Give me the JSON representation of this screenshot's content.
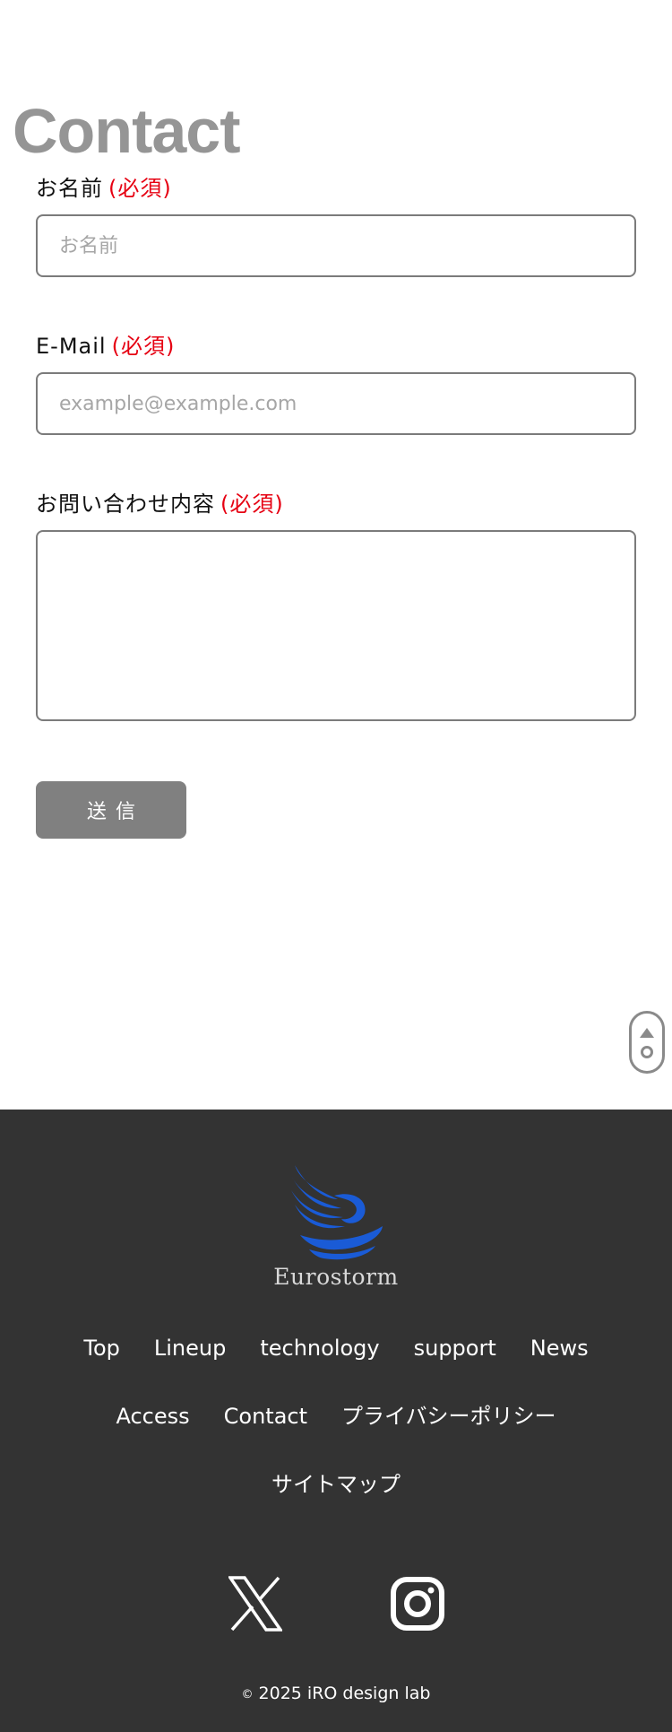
{
  "page": {
    "title": "Contact"
  },
  "form": {
    "name": {
      "label": "お名前",
      "required": "(必須)",
      "placeholder": "お名前",
      "value": ""
    },
    "email": {
      "label": "E-Mail",
      "required": "(必須)",
      "placeholder": "example@example.com",
      "value": ""
    },
    "message": {
      "label": "お問い合わせ内容",
      "required": "(必須)",
      "value": ""
    },
    "submit_label": "送信"
  },
  "footer": {
    "logo_text": "Eurostorm",
    "nav_rows": [
      [
        "Top",
        "Lineup",
        "technology",
        "support",
        "News"
      ],
      [
        "Access",
        "Contact",
        "プライバシーポリシー"
      ],
      [
        "サイトマップ"
      ]
    ],
    "copyright_mark": "©",
    "copyright": "2025 iRO design lab"
  },
  "colors": {
    "accent_required": "#e60012",
    "footer_bg": "#333333",
    "button_bg": "#808080",
    "title_gray": "#959595",
    "logo_blue": "#1a5bd6"
  },
  "icons": {
    "scroll_top": "scroll-to-top-icon",
    "logo": "bird-wave-logo",
    "social": [
      "x-icon",
      "instagram-icon"
    ]
  }
}
